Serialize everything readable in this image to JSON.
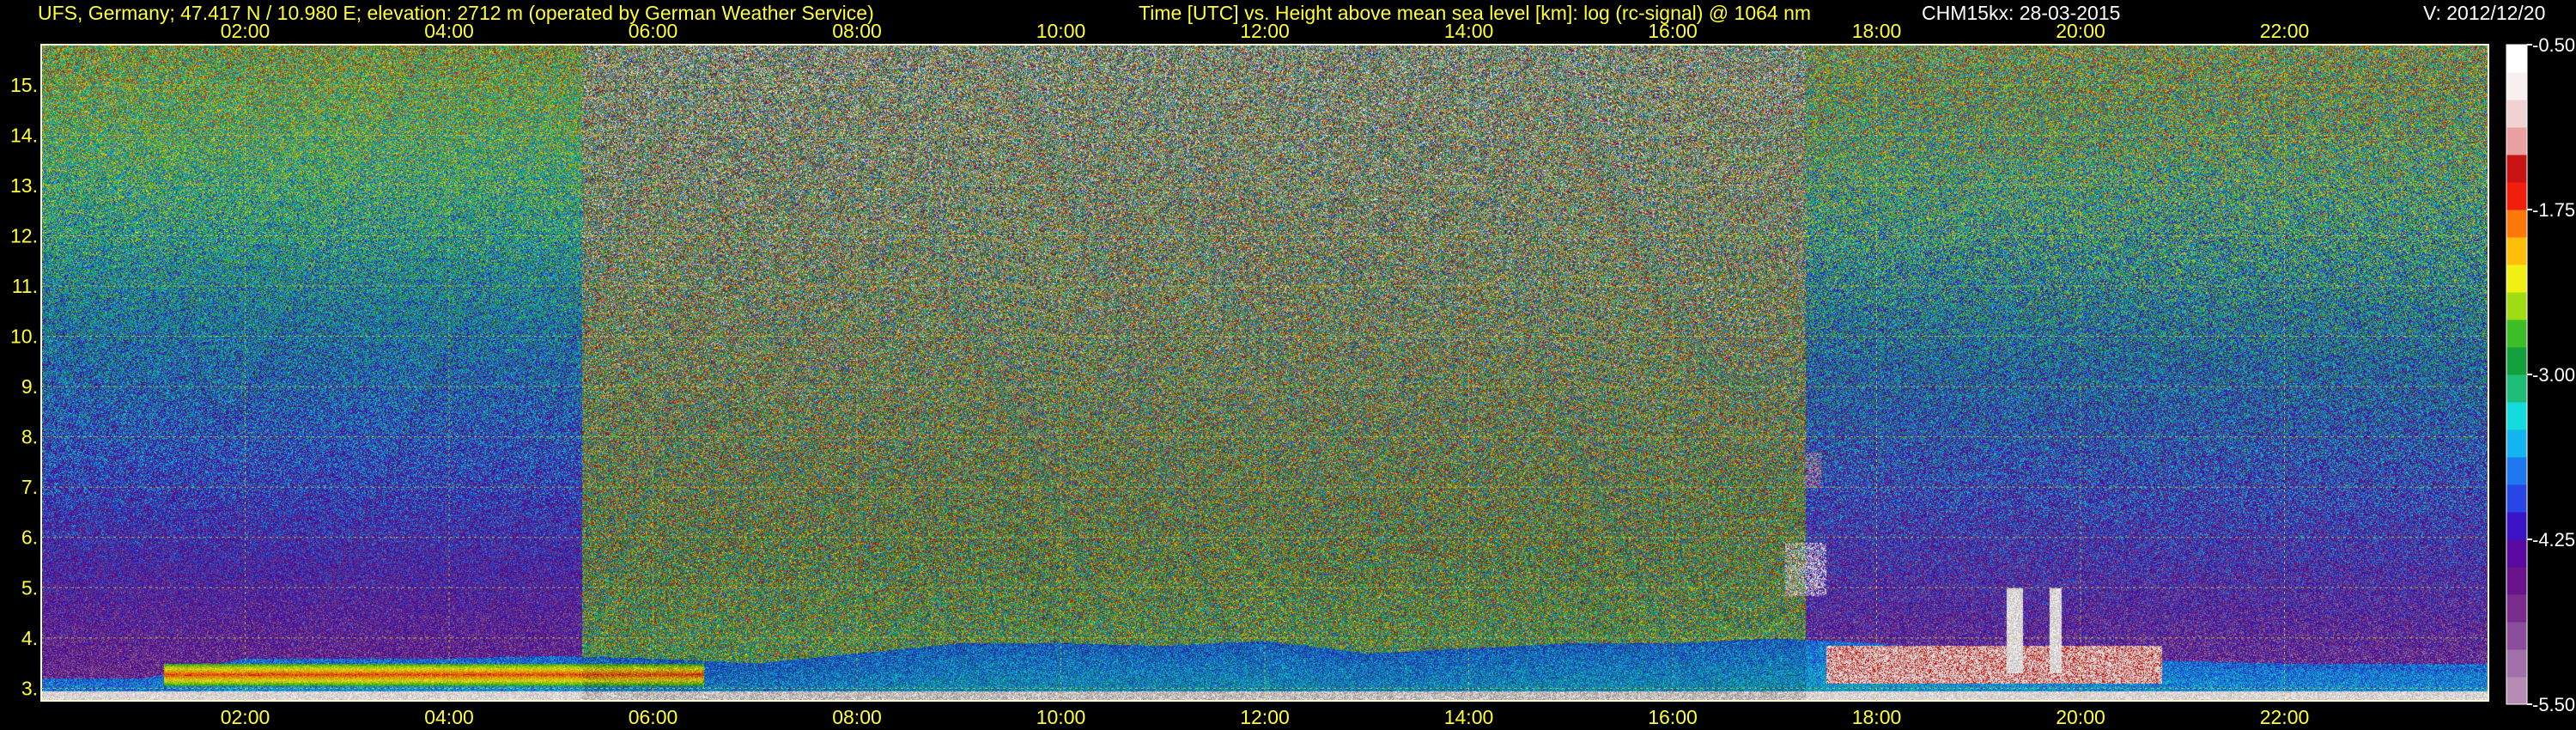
{
  "header": {
    "station": "UFS, Germany; 47.417 N / 10.980 E; elevation: 2712 m  (operated by German Weather Service)",
    "plot_title": "Time [UTC] vs. Height above mean sea level [km]: log (rc-signal) @ 1064 nm",
    "instrument_date": "CHM15kx: 28-03-2015",
    "version": "V: 2012/12/20"
  },
  "colors": {
    "text": "#ffff33",
    "grid": "#c8c832",
    "frame": "#ffffcc",
    "background": "#000000"
  },
  "chart_data": {
    "type": "heatmap",
    "x_unit": "hours UTC",
    "xlim": [
      0,
      24
    ],
    "ylim": [
      2.75,
      15.8
    ],
    "y_unit": "km",
    "x_ticks": [
      {
        "value": 2,
        "label": "02:00"
      },
      {
        "value": 4,
        "label": "04:00"
      },
      {
        "value": 6,
        "label": "06:00"
      },
      {
        "value": 8,
        "label": "08:00"
      },
      {
        "value": 10,
        "label": "10:00"
      },
      {
        "value": 12,
        "label": "12:00"
      },
      {
        "value": 14,
        "label": "14:00"
      },
      {
        "value": 16,
        "label": "16:00"
      },
      {
        "value": 18,
        "label": "18:00"
      },
      {
        "value": 20,
        "label": "20:00"
      },
      {
        "value": 22,
        "label": "22:00"
      }
    ],
    "y_ticks": [
      {
        "value": 3,
        "label": "3."
      },
      {
        "value": 4,
        "label": "4."
      },
      {
        "value": 5,
        "label": "5."
      },
      {
        "value": 6,
        "label": "6."
      },
      {
        "value": 7,
        "label": "7."
      },
      {
        "value": 8,
        "label": "8."
      },
      {
        "value": 9,
        "label": "9."
      },
      {
        "value": 10,
        "label": "10."
      },
      {
        "value": 11,
        "label": "11."
      },
      {
        "value": 12,
        "label": "12."
      },
      {
        "value": 13,
        "label": "13."
      },
      {
        "value": 14,
        "label": "14."
      },
      {
        "value": 15,
        "label": "15."
      }
    ],
    "colorbar": {
      "min": -5.5,
      "max": -0.5,
      "ticks": [
        {
          "value": -0.5,
          "label": "-0.50"
        },
        {
          "value": -1.75,
          "label": "-1.75"
        },
        {
          "value": -3.0,
          "label": "-3.00"
        },
        {
          "value": -4.25,
          "label": "-4.25"
        },
        {
          "value": -5.5,
          "label": "-5.50"
        }
      ],
      "colors": [
        "#b48cb4",
        "#a070a8",
        "#8c4c9c",
        "#7a2c8c",
        "#6a148c",
        "#5a0aa0",
        "#3c14c8",
        "#2846e6",
        "#1e78f0",
        "#14b4f0",
        "#14dcdc",
        "#1ebe78",
        "#14a03c",
        "#3cbe28",
        "#a0dc14",
        "#f0f014",
        "#ffbe0a",
        "#ff780a",
        "#f01e0a",
        "#c81414",
        "#e8a0a0",
        "#f0d2d2",
        "#f8f0f0",
        "#ffffff"
      ]
    },
    "features": [
      {
        "name": "boundary layer top",
        "t0": 0.0,
        "t1": 24.0,
        "h": [
          3.2,
          3.2,
          3.6,
          3.6,
          3.6,
          3.65,
          3.6,
          3.5,
          3.7,
          3.9,
          3.9,
          3.85,
          3.95,
          3.7,
          3.8,
          3.9,
          3.9,
          4.0,
          3.9,
          3.7,
          3.6,
          3.55,
          3.5,
          3.5
        ]
      },
      {
        "name": "night aerosol layer",
        "t0": 1.2,
        "t1": 6.5,
        "h_bottom": 3.05,
        "h_top": 3.5
      },
      {
        "name": "cloud",
        "t0": 17.1,
        "t1": 17.5,
        "h_bottom": 4.85,
        "h_top": 5.9
      },
      {
        "name": "cloud streak",
        "t0": 17.3,
        "t1": 17.45,
        "h_bottom": 7.0,
        "h_top": 7.7
      },
      {
        "name": "evening cloud layer",
        "t0": 17.5,
        "t1": 20.8,
        "h_bottom": 3.1,
        "h_top": 3.85
      },
      {
        "name": "cloud towers",
        "t0": 19.2,
        "t1": 19.9,
        "h_bottom": 3.3,
        "h_top": 5.0
      }
    ]
  }
}
